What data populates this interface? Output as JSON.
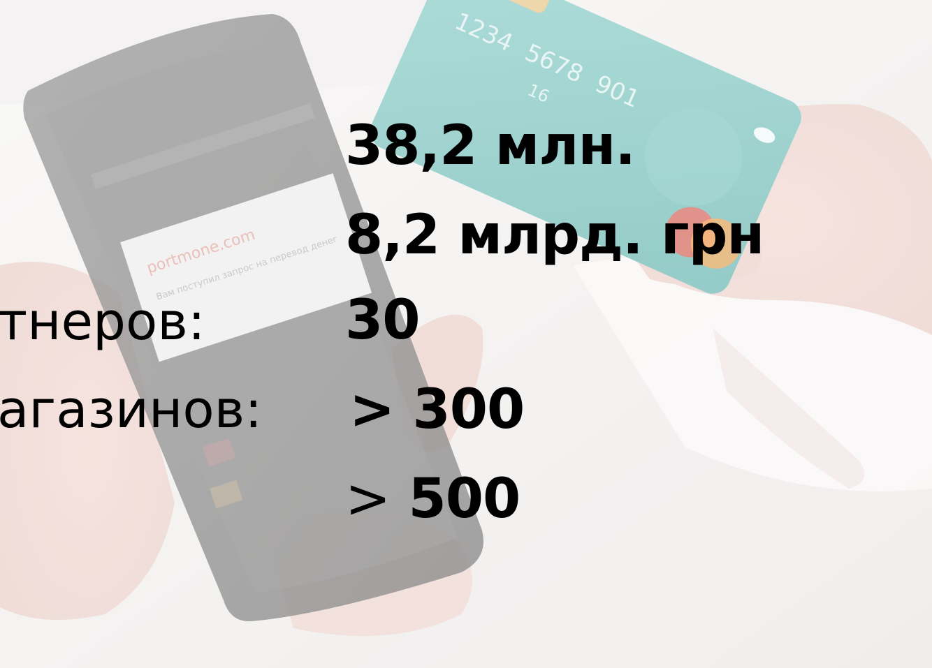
{
  "background": {
    "phone_app_name": "portmone.com",
    "phone_notification_text": "Вам поступил запрос на перевод денег",
    "card_number_fragments": [
      "1234",
      "5678",
      "901",
      "16"
    ],
    "colors": {
      "card": "#79c2bd",
      "card_chip": "#e8c98b",
      "logo_red": "#e85b4c",
      "logo_orange": "#f3a14a",
      "phone_body": "#6e6e6e",
      "page_bg": "#f4f2f1"
    }
  },
  "stats": {
    "rows": [
      {
        "label": "",
        "value": "38,2 млн."
      },
      {
        "label": "",
        "value": "8,2 млрд. грн"
      },
      {
        "label": "тнеров:",
        "value": "30"
      },
      {
        "label": "агазинов:",
        "value": "> 300"
      },
      {
        "label": "",
        "value_prefix": ">",
        "value": "500"
      }
    ]
  }
}
